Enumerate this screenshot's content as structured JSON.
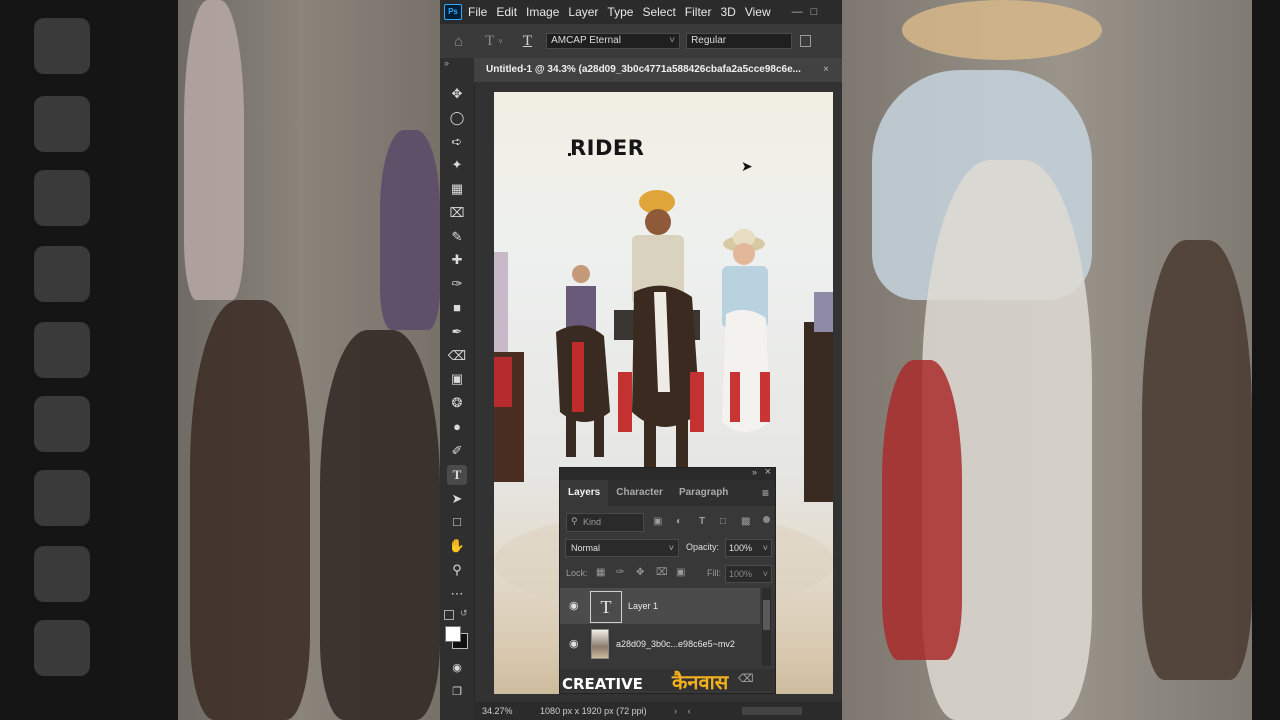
{
  "app": {
    "logo": "Ps",
    "menu": [
      "File",
      "Edit",
      "Image",
      "Layer",
      "Type",
      "Select",
      "Filter",
      "3D",
      "View"
    ]
  },
  "options_bar": {
    "font_family": "AMCAP Eternal",
    "font_style": "Regular"
  },
  "document": {
    "tab_title": "Untitled-1 @ 34.3% (a28d09_3b0c4771a588426cbafa2a5cce98c6e...",
    "canvas_text": "RIDER"
  },
  "status": {
    "zoom": "34.27%",
    "doc_info": "1080 px x 1920 px (72 ppi)"
  },
  "layers_panel": {
    "tabs": [
      "Layers",
      "Character",
      "Paragraph"
    ],
    "search_placeholder": "Kind",
    "blend_mode": "Normal",
    "opacity_label": "Opacity:",
    "opacity_value": "100%",
    "lock_label": "Lock:",
    "fill_label": "Fill:",
    "fill_value": "100%",
    "layers": [
      {
        "name": "Layer 1",
        "type": "text",
        "selected": true
      },
      {
        "name": "a28d09_3b0c...e98c6e5~mv2",
        "type": "image",
        "selected": false
      }
    ]
  },
  "watermark": {
    "text_en": "CREATIVE",
    "text_hi": "कैनवास"
  },
  "icons": [
    "home-icon",
    "type-tool-icon",
    "move-icon",
    "marquee-icon",
    "lasso-icon",
    "magic-wand-icon",
    "crop-icon",
    "frame-icon",
    "eyedropper-icon",
    "healing-icon",
    "brush-icon",
    "stamp-icon",
    "history-brush-icon",
    "eraser-icon",
    "gradient-icon",
    "blur-icon",
    "dodge-icon",
    "pen-icon",
    "path-select-icon",
    "rectangle-icon",
    "hand-icon",
    "zoom-icon",
    "more-icon",
    "eye-icon"
  ],
  "colors": {
    "ps_blue": "#31a8ff",
    "panel_bg": "#383838",
    "chrome_dark": "#2b2b2b",
    "watermark_gold": "#f2b01e"
  }
}
